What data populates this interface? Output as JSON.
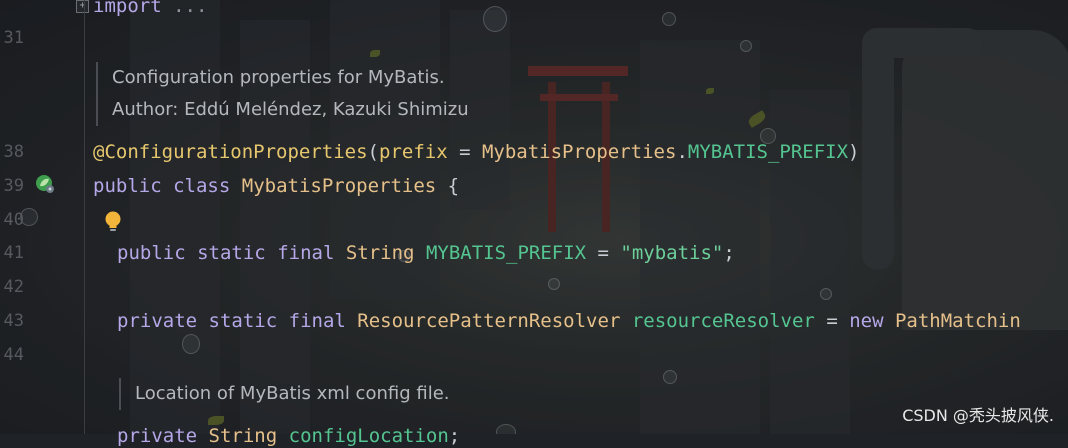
{
  "gutter": {
    "line_numbers": [
      "31",
      "38",
      "39",
      "40",
      "41",
      "42",
      "43",
      "44"
    ],
    "fold_symbol": "+"
  },
  "code": {
    "import_line": {
      "kw": "import",
      "rest": " ..."
    },
    "doc1": {
      "line1": "Configuration properties for MyBatis.",
      "line2": "Author: Eddú Meléndez, Kazuki Shimizu"
    },
    "annotation": {
      "name": "@ConfigurationProperties",
      "open": "(",
      "param": "prefix",
      "eq": " = ",
      "cls": "MybatisProperties",
      "dot": ".",
      "field": "MYBATIS_PREFIX",
      "close": ")"
    },
    "class_decl": {
      "kw1": "public",
      "kw2": "class",
      "name": "MybatisProperties",
      "brace": "{"
    },
    "field1": {
      "kw1": "public",
      "kw2": "static",
      "kw3": "final",
      "type": "String",
      "name": "MYBATIS_PREFIX",
      "eq": " = ",
      "value": "\"mybatis\"",
      "semi": ";"
    },
    "field2": {
      "kw1": "private",
      "kw2": "static",
      "kw3": "final",
      "type": "ResourcePatternResolver",
      "name": "resourceResolver",
      "eq": " = ",
      "kw4": "new",
      "ctor": "PathMatchin"
    },
    "doc2": {
      "line1": "Location of MyBatis xml config file."
    },
    "field3": {
      "kw1": "private",
      "type": "String",
      "name": "configLocation",
      "semi": ";"
    }
  },
  "icons": {
    "spring_bean": "spring-bean-icon",
    "bulb": "lightbulb-icon"
  },
  "watermark": "CSDN @秃头披风侠."
}
